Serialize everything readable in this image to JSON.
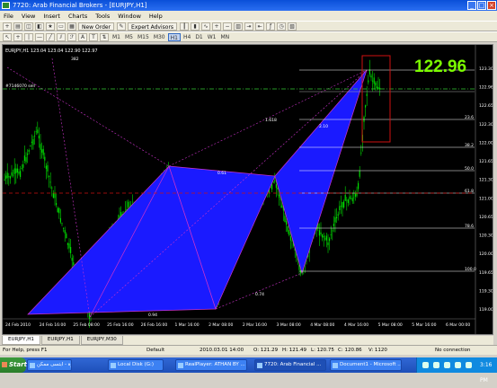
{
  "window": {
    "title": "7720: Arab Financial Brokers - [EURJPY,H1]"
  },
  "menu": [
    "File",
    "View",
    "Insert",
    "Charts",
    "Tools",
    "Window",
    "Help"
  ],
  "toolbar": {
    "new_order": "New Order",
    "expert_advisors": "Expert Advisors",
    "timeframes": [
      "M1",
      "M5",
      "M15",
      "M30",
      "H1",
      "H4",
      "D1",
      "W1",
      "MN"
    ],
    "active_timeframe": "H1"
  },
  "chart": {
    "header": "EURJPY,H1  123.04 123.04 122.90 122.97",
    "big_price": "122.96",
    "big_price_color": "#7cfc00",
    "line_label": "#7146070 sell",
    "price_axis": [
      "123.30",
      "122.96",
      "122.65",
      "122.30",
      "122.00",
      "121.65",
      "121.30",
      "121.00",
      "120.65",
      "120.30",
      "120.00",
      "119.65",
      "119.30",
      "119.00"
    ],
    "time_axis": [
      "24 Feb 2010",
      "24 Feb 16:00",
      "25 Feb 08:00",
      "25 Feb 16:00",
      "26 Feb 16:00",
      "1 Mar 16:00",
      "2 Mar 08:00",
      "2 Mar 16:00",
      "3 Mar 08:00",
      "4 Mar 08:00",
      "4 Mar 16:00",
      "5 Mar 08:00",
      "5 Mar 16:00",
      "6 Mar 00:00"
    ],
    "fib_labels": [
      "23.6",
      "38.2",
      "50.0",
      "61.8",
      "78.6",
      "100.0"
    ],
    "pattern_labels": [
      "382",
      "1.618",
      "2.10",
      "0.61",
      "0.74",
      "0.94"
    ],
    "bull_color": "#00dd00",
    "pattern_color": "#1a1aff",
    "pattern_edge_color": "#cc33cc",
    "box_color": "#d01010"
  },
  "tabs": [
    "EURJPY,H1",
    "EURJPY,H1",
    "EURJPY,M30"
  ],
  "active_tab": 0,
  "status": {
    "help": "For Help, press F1",
    "profile": "Default",
    "datetime": "2010.03.01 14:00",
    "open": "O: 121.29",
    "high": "H: 121.49",
    "low": "L: 120.75",
    "close": "C: 120.86",
    "volume": "V: 1120",
    "connection": "No connection"
  },
  "taskbar": {
    "start": "Start",
    "tasks": [
      "كوزة - ابتسى ممكن...",
      "Local Disk (G:)",
      "RealPlayer: ATHAN BY ...",
      "7720: Arab Financial ...",
      "Document1 - Microsoft ..."
    ],
    "active_task": 3,
    "clock": "3:16 PM"
  }
}
